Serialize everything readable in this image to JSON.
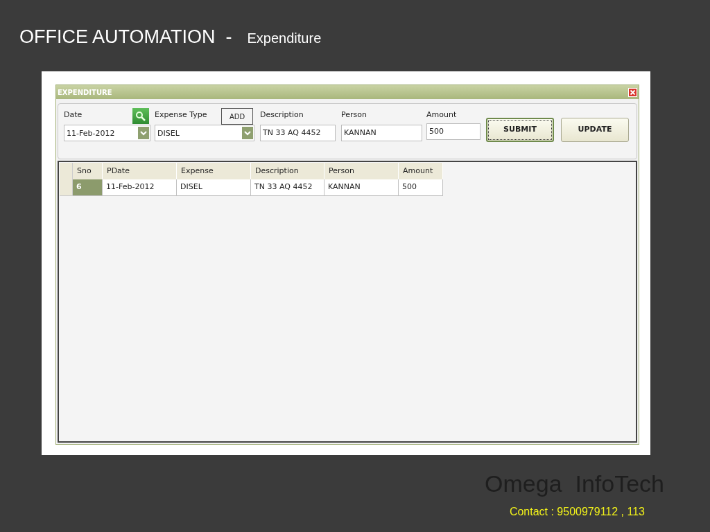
{
  "slide": {
    "title": "OFFICE AUTOMATION  -",
    "subtitle": "Expenditure",
    "company": "Omega  InfoTech",
    "contact": "Contact : 9500979112 , 113"
  },
  "window": {
    "title": "EXPENDITURE"
  },
  "form": {
    "fields": [
      {
        "label": "Date",
        "kind": "dropdown",
        "value": "11-Feb-2012",
        "action": {
          "kind": "search"
        }
      },
      {
        "label": "Expense Type",
        "kind": "dropdown",
        "value": "DISEL",
        "action": {
          "kind": "button",
          "label": "ADD"
        }
      },
      {
        "label": "Description",
        "kind": "text",
        "value": "TN 33 AQ 4452"
      },
      {
        "label": "Person",
        "kind": "text",
        "value": "KANNAN"
      },
      {
        "label": "Amount",
        "kind": "text",
        "value": "500"
      }
    ],
    "buttons": [
      {
        "label": "SUBMIT",
        "focused": true
      },
      {
        "label": "UPDATE",
        "focused": false
      }
    ]
  },
  "grid": {
    "columns": [
      "Sno",
      "PDate",
      "Expense",
      "Description",
      "Person",
      "Amount"
    ],
    "rows": [
      {
        "selected": true,
        "cells": [
          "6",
          "11-Feb-2012",
          "DISEL",
          "TN 33 AQ 4452",
          "KANNAN",
          "500"
        ]
      }
    ]
  }
}
